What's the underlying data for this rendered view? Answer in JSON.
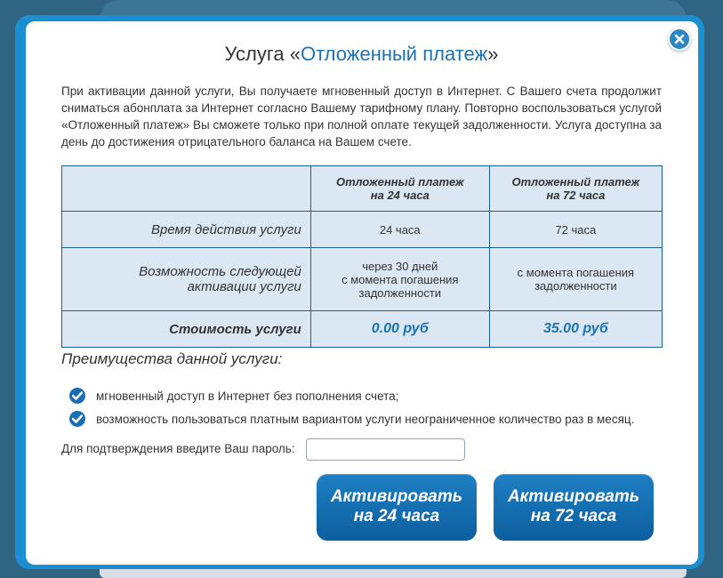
{
  "dialog": {
    "title_prefix": "Услуга «",
    "title_accent": "Отложенный платеж",
    "title_suffix": "»",
    "intro": "При активации данной услуги, Вы получаете мгновенный доступ в Интернет. С Вашего счета продолжит сниматься абонплата за Интернет согласно Вашему тарифному плану. Повторно воспользоваться услугой «Отложенный платеж» Вы сможете только при полной оплате текущей задолженности. Услуга доступна за день до достижения отрицательного баланса на Вашем счете."
  },
  "table": {
    "header_a_line1": "Отложенный платеж",
    "header_a_line2": "на 24 часа",
    "header_b_line1": "Отложенный платеж",
    "header_b_line2": "на 72 часа",
    "row_time_label": "Время действия услуги",
    "row_time_a": "24 часа",
    "row_time_b": "72 часа",
    "row_next_label_line1": "Возможность следующей",
    "row_next_label_line2": "активации услуги",
    "row_next_a_line1": "через 30 дней",
    "row_next_a_line2": "с момента погашения",
    "row_next_a_line3": "задолженности",
    "row_next_b_line1": "с момента погашения",
    "row_next_b_line2": "задолженности",
    "row_cost_label": "Стоимость услуги",
    "row_cost_a": "0.00 руб",
    "row_cost_b": "35.00 руб"
  },
  "advantages": {
    "title": "Преимущества данной услуги:",
    "items": [
      "мгновенный доступ в Интернет без пополнения счета;",
      "возможность пользоваться платным вариантом услуги неограниченное количество раз в месяц."
    ]
  },
  "password": {
    "label": "Для подтверждения введите Ваш пароль:",
    "value": ""
  },
  "buttons": {
    "activate_24_line1": "Активировать",
    "activate_24_line2": "на 24 часа",
    "activate_72_line1": "Активировать",
    "activate_72_line2": "на 72 часа"
  },
  "icons": {
    "close": "close-icon",
    "check": "check-circle-icon"
  },
  "colors": {
    "accent": "#1b72b5",
    "frame": "#1b8fd0",
    "table_bg": "#dbe8f3",
    "button": "#0d5f9e"
  }
}
